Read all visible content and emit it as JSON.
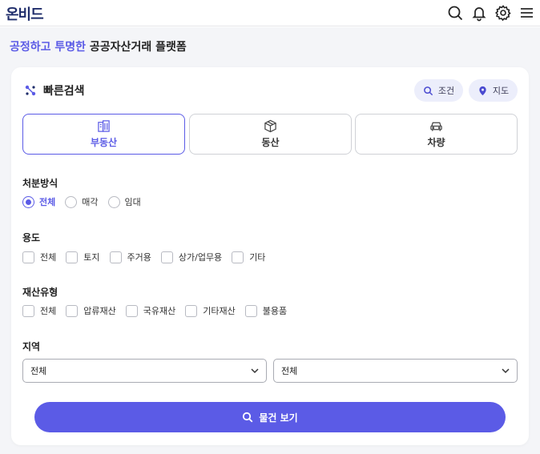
{
  "header": {
    "logo": "온비드",
    "icons": [
      "search-icon",
      "bell-icon",
      "gear-icon",
      "menu-icon"
    ]
  },
  "tagline": {
    "accent": "공정하고 투명한",
    "rest": " 공공자산거래 플랫폼"
  },
  "quick_search": {
    "title": "빠른검색",
    "condition_label": "조건",
    "map_label": "지도"
  },
  "categories": [
    {
      "label": "부동산",
      "icon": "building-icon",
      "active": true
    },
    {
      "label": "동산",
      "icon": "box-icon",
      "active": false
    },
    {
      "label": "차량",
      "icon": "car-icon",
      "active": false
    }
  ],
  "disposal": {
    "label": "처분방식",
    "options": [
      "전체",
      "매각",
      "임대"
    ],
    "selected": "전체"
  },
  "usage": {
    "label": "용도",
    "options": [
      "전체",
      "토지",
      "주거용",
      "상가/업무용",
      "기타"
    ]
  },
  "asset_type": {
    "label": "재산유형",
    "options": [
      "전체",
      "압류재산",
      "국유재산",
      "기타재산",
      "불용품"
    ]
  },
  "region": {
    "label": "지역",
    "select1": "전체",
    "select2": "전체"
  },
  "search_button": "물건 보기",
  "colors": {
    "accent": "#5b5be6",
    "logo": "#1f2d6b",
    "pill_bg": "#eceefb",
    "page_bg": "#f4f5f8"
  }
}
